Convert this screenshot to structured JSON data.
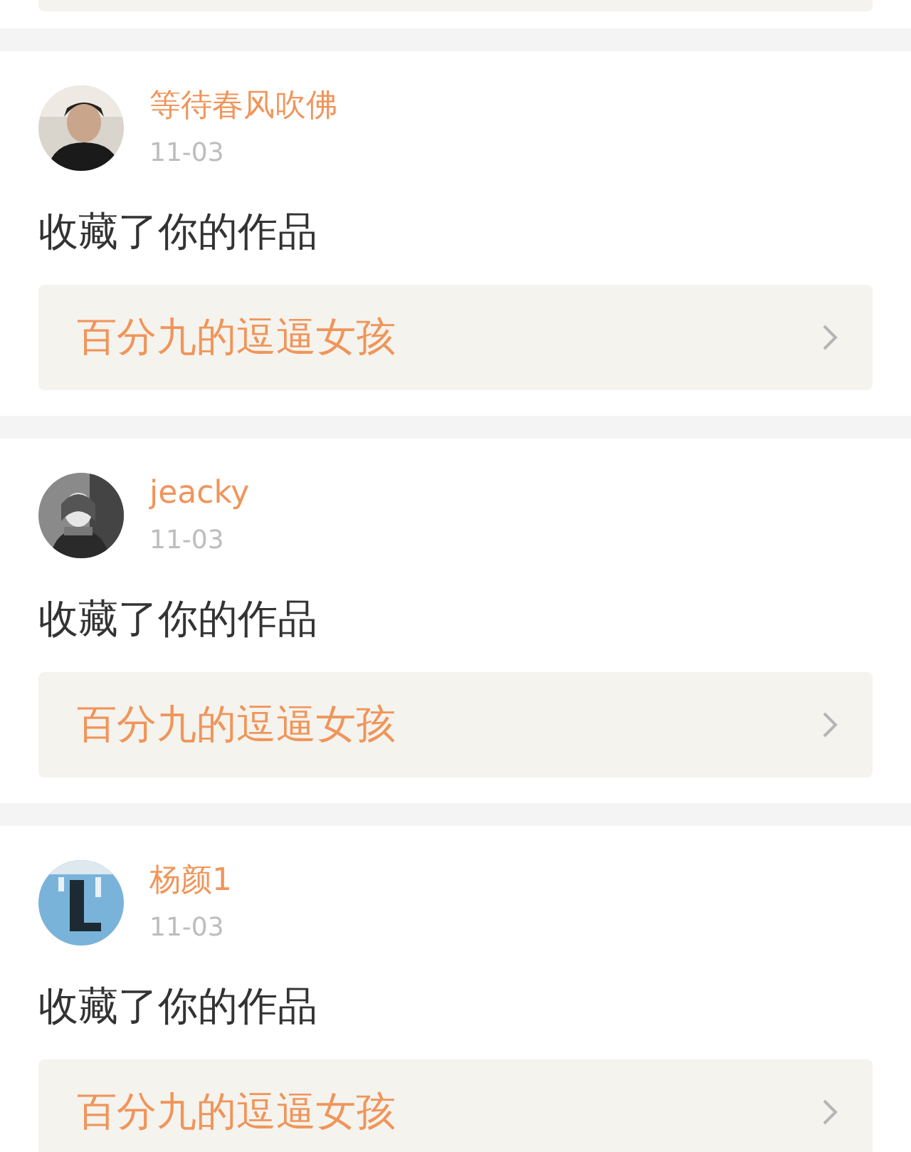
{
  "notifications": [
    {
      "user": "等待春风吹佛",
      "date": "11-03",
      "action": "收藏了你的作品",
      "work": "百分九的逗逼女孩"
    },
    {
      "user": "jeacky",
      "date": "11-03",
      "action": "收藏了你的作品",
      "work": "百分九的逗逼女孩"
    },
    {
      "user": "杨颜1",
      "date": "11-03",
      "action": "收藏了你的作品",
      "work": "百分九的逗逼女孩"
    }
  ]
}
